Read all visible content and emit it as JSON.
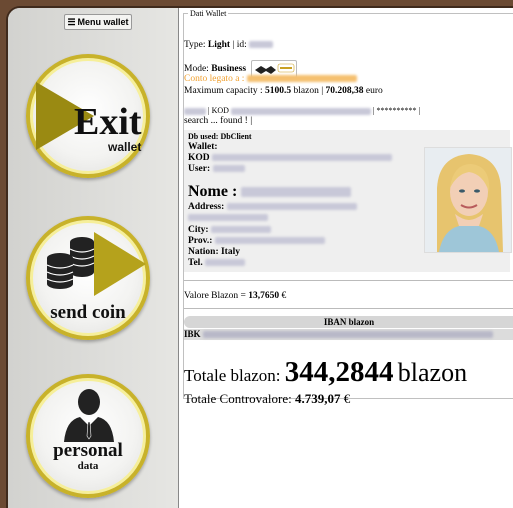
{
  "sidebar": {
    "menu_label": "Menu wallet",
    "menu_icon": "list-icon",
    "exit": {
      "word": "Exit",
      "sub": "wallet"
    },
    "send": {
      "label": "send coin"
    },
    "personal": {
      "label": "personal",
      "sub": "data"
    }
  },
  "wallet": {
    "legend": "Dati Wallet",
    "type_label": "Type:",
    "type_value": "Light",
    "id_label": "| id:",
    "mode_label": "Mode:",
    "mode_value": "Business",
    "conto_label": "Conto legato a :",
    "capacity_label": "Maximum capacity :",
    "capacity_blazon": "5100.5",
    "capacity_sep": "blazon |",
    "capacity_euro": "70.208,38",
    "capacity_unit": "euro",
    "kod_prefix": "| KOD",
    "kod_mask": "| ********** |",
    "search_text": "search ... found ! |",
    "db_used": "Db used: DbClient",
    "wallet_label": "Wallet:",
    "kod_label": "KOD",
    "user_label": "User:",
    "nome_label": "Nome :",
    "address_label": "Address:",
    "city_label": "City:",
    "prov_label": "Prov.:",
    "nation_label": "Nation: Italy",
    "tel_label": "Tel.",
    "valore_label": "Valore Blazon =",
    "valore_value": "13,7650",
    "valore_unit": "€",
    "iban_head": "IBAN blazon",
    "ibk_label": "IBK",
    "totale_label": "Totale blazon:",
    "totale_value": "344,2844",
    "totale_unit": "blazon",
    "contro_label": "Totale Controvalore:",
    "contro_value": "4.739,07",
    "contro_unit": "€"
  },
  "colors": {
    "accent": "#c8b22a",
    "frame": "#6b4a33",
    "orange": "#f0a030"
  }
}
